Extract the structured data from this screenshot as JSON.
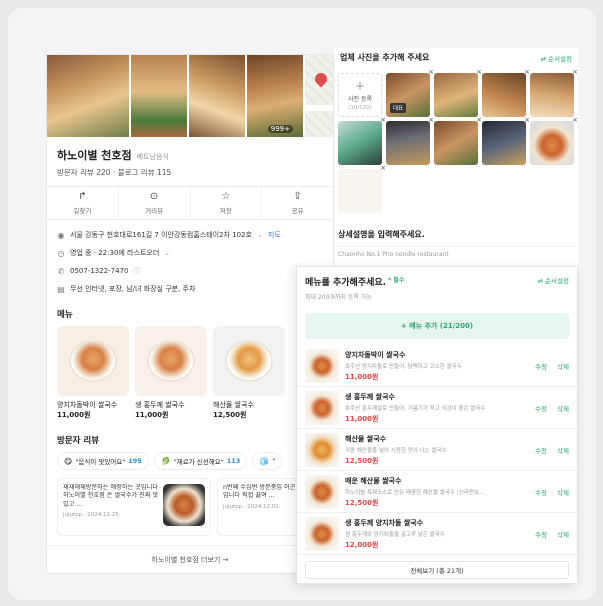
{
  "place": {
    "name": "하노이별 천호점",
    "category": "베트남음식",
    "reviews_line": "방문자 리뷰 220 · 블로그 리뷰 115",
    "photo_count": "999+",
    "actions": [
      {
        "icon": "share-arrow-icon",
        "label": "길찾기"
      },
      {
        "icon": "location-pin-icon",
        "label": "거리뷰"
      },
      {
        "icon": "star-icon",
        "label": "저장"
      },
      {
        "icon": "share-icon",
        "label": "공유"
      }
    ],
    "address": "서울 강동구 천호대로161길 7 이안강동컴홈스테이2차 102호",
    "address_link": "지도",
    "hours_status": "영업 중 · 22:30에 라스트오더",
    "phone": "0507-1322-7470",
    "facilities": "무선 인터넷, 포장, 남/녀 화장실 구분, 주차",
    "menu_heading": "메뉴",
    "menu_items": [
      {
        "name": "양지차돌박이 쌀국수",
        "price": "11,000원"
      },
      {
        "name": "생 홍두께 쌀국수",
        "price": "11,000원"
      },
      {
        "name": "해산물 쌀국수",
        "price": "12,500원"
      }
    ],
    "review_heading": "방문자 리뷰",
    "review_chips": [
      {
        "emoji": "😋",
        "text": "\"음식이 맛있어요\"",
        "count": "195"
      },
      {
        "emoji": "🥬",
        "text": "\"재료가 신선해요\"",
        "count": "113"
      },
      {
        "emoji": "🧊",
        "text": "\"",
        "count": ""
      }
    ],
    "review_cards": [
      {
        "text": "재재재재방문하는 애정하는 곳입니다 하노이별 천호점 은 쌀국수가 진짜 맛있고 ...",
        "meta": "jujutop · 2024.11.25."
      },
      {
        "text": "n번째 수십번 방문중입 이곤처에 오면 꼭 들르 국수집입니다 직접 끓여 ...",
        "meta": "jujutop · 2024.12.01."
      }
    ],
    "more_link": "하노이별 천호점 더보기 →"
  },
  "photo_panel": {
    "heading": "업체 사진을 추가해 주세요",
    "order_link": "⇄ 순서설정",
    "add_label": "사진 등록",
    "add_count": "(10/120)",
    "rep_tag": "대표",
    "close_glyph": "×",
    "desc_heading": "상세설명을 입력해주세요.",
    "desc_placeholder": "Chaonho No.1 Pho noodle restaurant"
  },
  "menu_panel": {
    "title": "메뉴를 추가해주세요.",
    "required": "* 필수",
    "order_link": "⇄ 순서설정",
    "subtitle": "최대 200개까지 등록 가능",
    "add_button": "+ 메뉴 추가 (21/200)",
    "edit_label": "수정",
    "delete_label": "삭제",
    "rows": [
      {
        "name": "양지차돌박이 쌀국수",
        "desc": "호주산 양지차돌로 만들어, 담백하고 고소한 쌀국수",
        "price": "11,000원"
      },
      {
        "name": "생 홍두께 쌀국수",
        "desc": "호주산 홍두께살로 만들어, 기름기가 적고 식감이 좋은 쌀국수",
        "price": "11,000원"
      },
      {
        "name": "해산물 쌀국수",
        "desc": "각종 해산물을 넣어 시원한 맛이 나는 쌀국수",
        "price": "12,500원"
      },
      {
        "name": "매운 해산물 쌀국수",
        "desc": "하노이별 특제소스로 만든 매콤한 해산물 쌀국수 (신라면보...",
        "price": "12,500원"
      },
      {
        "name": "생 홍두께 양지차돌 쌀국수",
        "desc": "생 홍두께와 양지차돌을 골고루 넣은 쌀국수",
        "price": "12,000원"
      }
    ],
    "view_all": "전체보기 (총 21개)"
  }
}
